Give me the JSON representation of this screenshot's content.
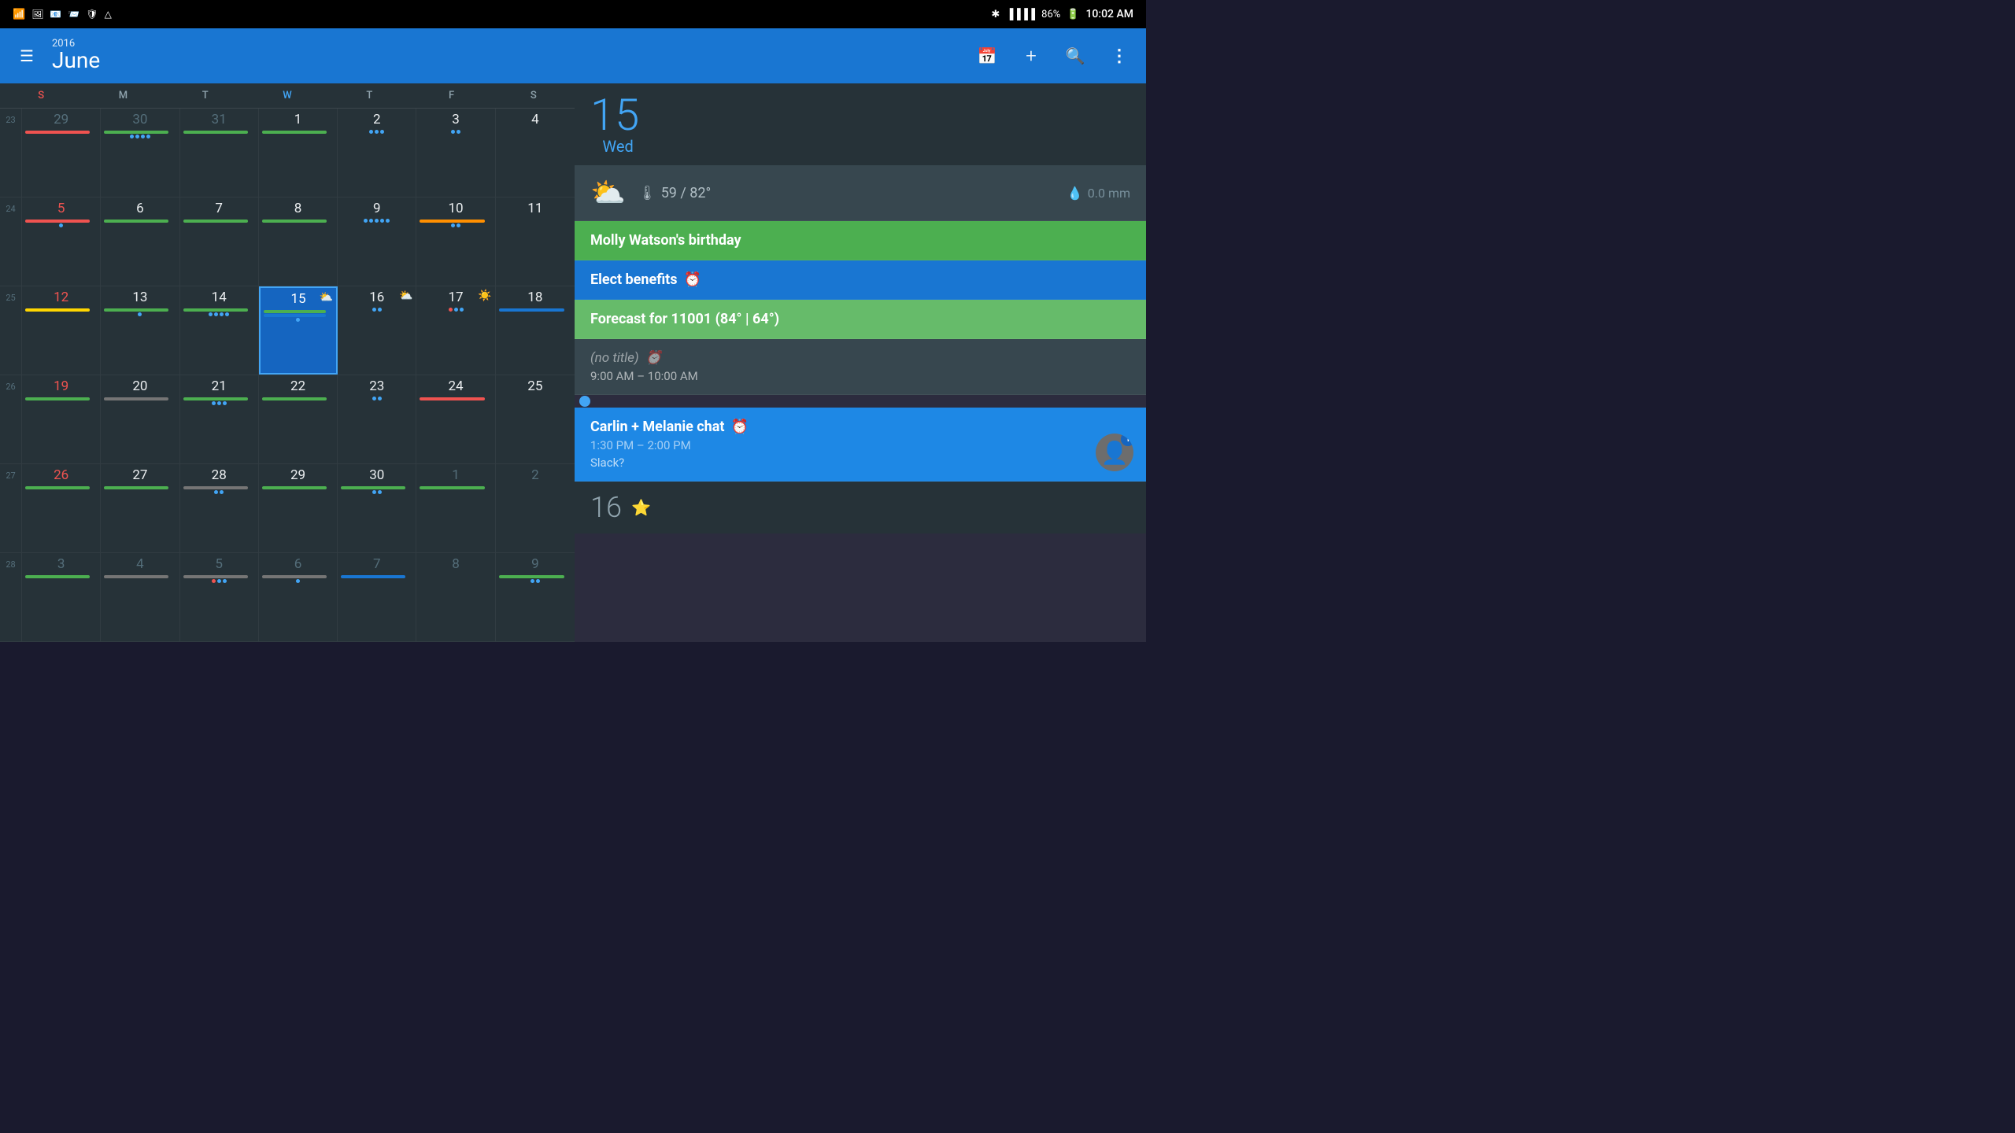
{
  "statusBar": {
    "leftIcons": [
      "wifi",
      "image",
      "outlook",
      "outlook2",
      "shield",
      "drive"
    ],
    "bluetooth": "⚡",
    "wifi": "wifi",
    "signal": "▐▐▐▐",
    "battery": "86%",
    "time": "10:02 AM"
  },
  "header": {
    "year": "2016",
    "month": "June",
    "menuIcon": "☰",
    "calendarIcon": "📅",
    "addIcon": "+",
    "searchIcon": "🔍",
    "moreIcon": "⋮"
  },
  "calendar": {
    "daysOfWeek": [
      "S",
      "M",
      "T",
      "W",
      "T",
      "F",
      "S"
    ],
    "weeks": [
      {
        "weekNum": "23",
        "days": [
          {
            "num": "29",
            "type": "other-month",
            "dow": "sunday",
            "bars": [
              {
                "color": "#ef5350"
              }
            ],
            "dots": []
          },
          {
            "num": "30",
            "type": "other-month",
            "dow": "monday",
            "bars": [
              {
                "color": "#4caf50"
              }
            ],
            "dots": [
              {
                "color": "#42a5f5"
              },
              {
                "color": "#42a5f5"
              },
              {
                "color": "#42a5f5"
              },
              {
                "color": "#42a5f5"
              }
            ]
          },
          {
            "num": "31",
            "type": "other-month",
            "dow": "tuesday",
            "bars": [
              {
                "color": "#4caf50"
              }
            ],
            "dots": []
          },
          {
            "num": "1",
            "type": "current",
            "dow": "wednesday",
            "bars": [
              {
                "color": "#4caf50"
              }
            ],
            "dots": []
          },
          {
            "num": "2",
            "type": "current",
            "dow": "thursday",
            "bars": [],
            "dots": [
              {
                "color": "#42a5f5"
              },
              {
                "color": "#42a5f5"
              },
              {
                "color": "#42a5f5"
              }
            ]
          },
          {
            "num": "3",
            "type": "current",
            "dow": "friday",
            "bars": [],
            "dots": [
              {
                "color": "#42a5f5"
              },
              {
                "color": "#42a5f5"
              }
            ]
          },
          {
            "num": "4",
            "type": "current",
            "dow": "saturday",
            "bars": [],
            "dots": []
          }
        ]
      },
      {
        "weekNum": "24",
        "days": [
          {
            "num": "5",
            "type": "current",
            "dow": "sunday",
            "bars": [
              {
                "color": "#ef5350"
              }
            ],
            "dots": [
              {
                "color": "#42a5f5"
              }
            ]
          },
          {
            "num": "6",
            "type": "current",
            "dow": "monday",
            "bars": [
              {
                "color": "#4caf50"
              }
            ],
            "dots": []
          },
          {
            "num": "7",
            "type": "current",
            "dow": "tuesday",
            "bars": [
              {
                "color": "#4caf50"
              }
            ],
            "dots": []
          },
          {
            "num": "8",
            "type": "current",
            "dow": "wednesday",
            "bars": [
              {
                "color": "#4caf50"
              }
            ],
            "dots": []
          },
          {
            "num": "9",
            "type": "current",
            "dow": "thursday",
            "bars": [],
            "dots": [
              {
                "color": "#42a5f5"
              },
              {
                "color": "#42a5f5"
              },
              {
                "color": "#42a5f5"
              },
              {
                "color": "#42a5f5"
              },
              {
                "color": "#42a5f5"
              }
            ]
          },
          {
            "num": "10",
            "type": "current",
            "dow": "friday",
            "bars": [
              {
                "color": "#ff8f00"
              }
            ],
            "dots": [
              {
                "color": "#42a5f5"
              },
              {
                "color": "#42a5f5"
              }
            ]
          },
          {
            "num": "11",
            "type": "current",
            "dow": "saturday",
            "bars": [],
            "dots": []
          }
        ]
      },
      {
        "weekNum": "25",
        "days": [
          {
            "num": "12",
            "type": "current",
            "dow": "sunday",
            "bars": [
              {
                "color": "#ffd600"
              }
            ],
            "dots": []
          },
          {
            "num": "13",
            "type": "current",
            "dow": "monday",
            "bars": [
              {
                "color": "#4caf50"
              }
            ],
            "dots": [
              {
                "color": "#42a5f5"
              }
            ]
          },
          {
            "num": "14",
            "type": "current",
            "dow": "tuesday",
            "bars": [
              {
                "color": "#4caf50"
              }
            ],
            "dots": [
              {
                "color": "#42a5f5"
              },
              {
                "color": "#42a5f5"
              },
              {
                "color": "#42a5f5"
              },
              {
                "color": "#42a5f5"
              }
            ]
          },
          {
            "num": "15",
            "type": "today",
            "dow": "wednesday",
            "bars": [
              {
                "color": "#4caf50"
              },
              {
                "color": "#1976d2"
              }
            ],
            "dots": [
              {
                "color": "#42a5f5"
              }
            ],
            "weather": "⛅"
          },
          {
            "num": "16",
            "type": "current",
            "dow": "thursday",
            "bars": [],
            "dots": [
              {
                "color": "#42a5f5"
              },
              {
                "color": "#42a5f5"
              }
            ],
            "weather": "⛅"
          },
          {
            "num": "17",
            "type": "current",
            "dow": "friday",
            "bars": [],
            "dots": [
              {
                "color": "#ef5350"
              },
              {
                "color": "#42a5f5"
              },
              {
                "color": "#42a5f5"
              }
            ],
            "weather": "☀️"
          },
          {
            "num": "18",
            "type": "current",
            "dow": "saturday",
            "bars": [
              {
                "color": "#1976d2"
              }
            ],
            "dots": []
          }
        ]
      },
      {
        "weekNum": "26",
        "days": [
          {
            "num": "19",
            "type": "current",
            "dow": "sunday",
            "bars": [
              {
                "color": "#4caf50"
              }
            ],
            "dots": []
          },
          {
            "num": "20",
            "type": "current",
            "dow": "monday",
            "bars": [
              {
                "color": "#757575"
              }
            ],
            "dots": []
          },
          {
            "num": "21",
            "type": "current",
            "dow": "tuesday",
            "bars": [
              {
                "color": "#4caf50"
              }
            ],
            "dots": [
              {
                "color": "#42a5f5"
              },
              {
                "color": "#42a5f5"
              },
              {
                "color": "#42a5f5"
              }
            ]
          },
          {
            "num": "22",
            "type": "current",
            "dow": "wednesday",
            "bars": [
              {
                "color": "#4caf50"
              }
            ],
            "dots": []
          },
          {
            "num": "23",
            "type": "current",
            "dow": "thursday",
            "bars": [],
            "dots": [
              {
                "color": "#42a5f5"
              },
              {
                "color": "#42a5f5"
              }
            ]
          },
          {
            "num": "24",
            "type": "current",
            "dow": "friday",
            "bars": [
              {
                "color": "#ef5350"
              }
            ],
            "dots": []
          },
          {
            "num": "25",
            "type": "current",
            "dow": "saturday",
            "bars": [],
            "dots": []
          }
        ]
      },
      {
        "weekNum": "27",
        "days": [
          {
            "num": "26",
            "type": "current",
            "dow": "sunday",
            "bars": [
              {
                "color": "#4caf50"
              }
            ],
            "dots": []
          },
          {
            "num": "27",
            "type": "current",
            "dow": "monday",
            "bars": [
              {
                "color": "#4caf50"
              }
            ],
            "dots": []
          },
          {
            "num": "28",
            "type": "current",
            "dow": "tuesday",
            "bars": [
              {
                "color": "#757575"
              }
            ],
            "dots": [
              {
                "color": "#42a5f5"
              },
              {
                "color": "#42a5f5"
              }
            ]
          },
          {
            "num": "29",
            "type": "current",
            "dow": "wednesday",
            "bars": [
              {
                "color": "#4caf50"
              }
            ],
            "dots": []
          },
          {
            "num": "30",
            "type": "current",
            "dow": "thursday",
            "bars": [
              {
                "color": "#4caf50"
              }
            ],
            "dots": [
              {
                "color": "#42a5f5"
              },
              {
                "color": "#42a5f5"
              }
            ]
          },
          {
            "num": "1",
            "type": "other-month",
            "dow": "friday",
            "bars": [
              {
                "color": "#4caf50"
              }
            ],
            "dots": []
          },
          {
            "num": "2",
            "type": "other-month",
            "dow": "saturday",
            "bars": [],
            "dots": []
          }
        ]
      },
      {
        "weekNum": "28",
        "days": [
          {
            "num": "3",
            "type": "other-month",
            "dow": "sunday",
            "bars": [
              {
                "color": "#4caf50"
              }
            ],
            "dots": []
          },
          {
            "num": "4",
            "type": "other-month",
            "dow": "monday",
            "bars": [
              {
                "color": "#757575"
              }
            ],
            "dots": []
          },
          {
            "num": "5",
            "type": "other-month",
            "dow": "tuesday",
            "bars": [
              {
                "color": "#757575"
              }
            ],
            "dots": [
              {
                "color": "#ef5350"
              },
              {
                "color": "#42a5f5"
              },
              {
                "color": "#42a5f5"
              }
            ]
          },
          {
            "num": "6",
            "type": "other-month",
            "dow": "wednesday",
            "bars": [
              {
                "color": "#757575"
              }
            ],
            "dots": [
              {
                "color": "#42a5f5"
              }
            ]
          },
          {
            "num": "7",
            "type": "other-month",
            "dow": "thursday",
            "bars": [
              {
                "color": "#1976d2"
              }
            ],
            "dots": []
          },
          {
            "num": "8",
            "type": "other-month",
            "dow": "friday",
            "bars": [],
            "dots": []
          },
          {
            "num": "9",
            "type": "other-month",
            "dow": "saturday",
            "bars": [
              {
                "color": "#4caf50"
              }
            ],
            "dots": [
              {
                "color": "#42a5f5"
              },
              {
                "color": "#42a5f5"
              }
            ]
          }
        ]
      }
    ]
  },
  "dayDetail": {
    "dayNumber": "15",
    "dayName": "Wed",
    "weather": {
      "icon": "⛅",
      "tempRange": "59 / 82°",
      "precipitation": "0.0 mm"
    },
    "events": [
      {
        "id": "birthday",
        "type": "green",
        "title": "Molly Watson's birthday",
        "titleIcon": null,
        "subtitle": null
      },
      {
        "id": "elect-benefits",
        "type": "blue",
        "title": "Elect benefits",
        "titleIcon": "⏰",
        "subtitle": null
      },
      {
        "id": "forecast",
        "type": "green-light",
        "title": "Forecast for 11001 (84° | 64°)",
        "titleIcon": null,
        "subtitle": null
      },
      {
        "id": "no-title",
        "type": "dark",
        "title": "(no title)",
        "titleIcon": "⏰",
        "timeRange": "9:00 AM – 10:00 AM"
      }
    ],
    "blueDotEvent": true,
    "chatEvent": {
      "id": "carlin-melanie",
      "type": "blue-medium",
      "title": "Carlin + Melanie chat",
      "titleIcon": "⏰",
      "timeRange": "1:30 PM – 2:00 PM",
      "subtitle": "Slack?",
      "avatar": "👤",
      "badgeCount": "1"
    }
  },
  "nextDay": {
    "dayNumber": "16",
    "icon": "⭐"
  }
}
